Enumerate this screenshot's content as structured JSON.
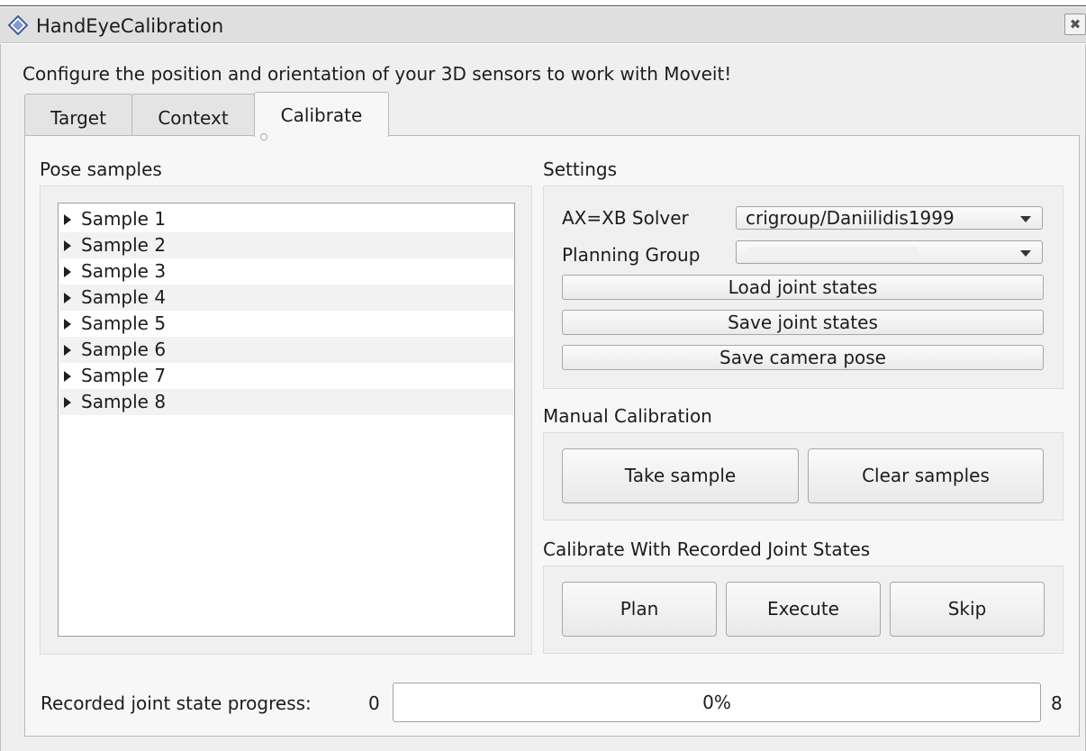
{
  "window": {
    "title": "HandEyeCalibration",
    "close_glyph": "✖"
  },
  "description": "Configure the position and orientation of your 3D sensors to work with Moveit!",
  "tabs": [
    {
      "label": "Target",
      "active": false
    },
    {
      "label": "Context",
      "active": false
    },
    {
      "label": "Calibrate",
      "active": true
    }
  ],
  "pose_samples": {
    "title": "Pose samples",
    "items": [
      "Sample 1",
      "Sample 2",
      "Sample 3",
      "Sample 4",
      "Sample 5",
      "Sample 6",
      "Sample 7",
      "Sample 8"
    ]
  },
  "settings": {
    "title": "Settings",
    "solver_label": "AX=XB Solver",
    "solver_value": "crigroup/Daniilidis1999",
    "planning_group_label": "Planning Group",
    "planning_group_value": "",
    "load_joint_states": "Load joint states",
    "save_joint_states": "Save joint states",
    "save_camera_pose": "Save camera pose"
  },
  "manual_calibration": {
    "title": "Manual Calibration",
    "take_sample": "Take sample",
    "clear_samples": "Clear samples"
  },
  "recorded_calibration": {
    "title": "Calibrate With Recorded Joint States",
    "plan": "Plan",
    "execute": "Execute",
    "skip": "Skip"
  },
  "progress": {
    "label": "Recorded joint state progress:",
    "min": "0",
    "max": "8",
    "text": "0%",
    "value": 0
  },
  "colors": {
    "progress_fill": "#3a84d6",
    "title_icon": "#4a6fb5"
  }
}
